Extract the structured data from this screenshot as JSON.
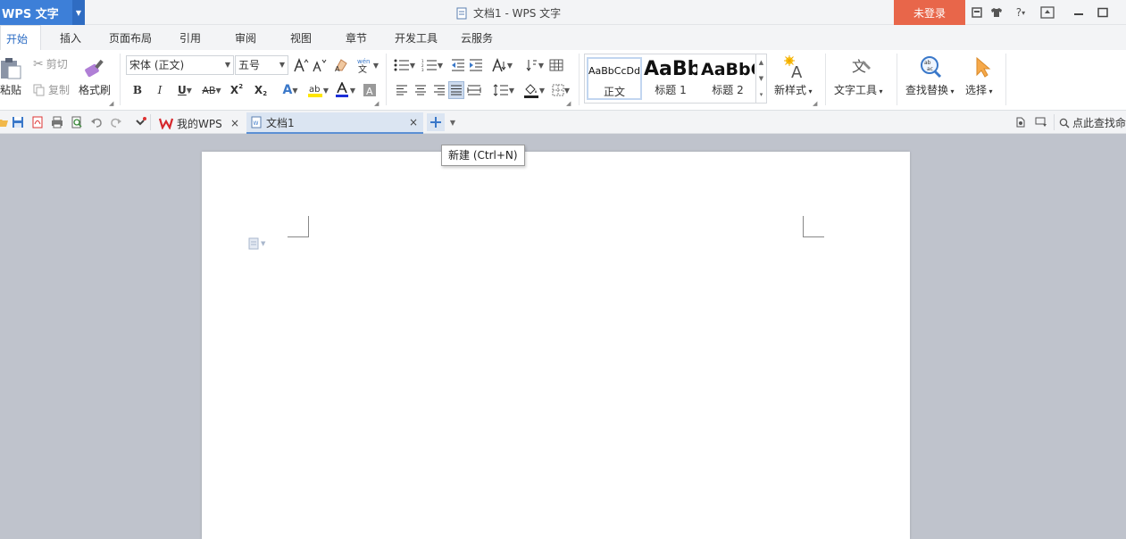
{
  "titlebar": {
    "app_name": "WPS 文字",
    "window_title": "文档1 - WPS 文字",
    "login_label": "未登录",
    "help_label": "?"
  },
  "ribbon_tabs": [
    {
      "label": "开始"
    },
    {
      "label": "插入"
    },
    {
      "label": "页面布局"
    },
    {
      "label": "引用"
    },
    {
      "label": "审阅"
    },
    {
      "label": "视图"
    },
    {
      "label": "章节"
    },
    {
      "label": "开发工具"
    },
    {
      "label": "云服务"
    }
  ],
  "clipboard": {
    "paste_label": "粘贴",
    "cut_label": "剪切",
    "copy_label": "复制",
    "format_painter_label": "格式刷"
  },
  "font": {
    "font_name": "宋体 (正文)",
    "font_size": "五号"
  },
  "styles": {
    "items": [
      {
        "sample": "AaBbCcDd",
        "caption": "正文"
      },
      {
        "sample": "AaBb",
        "caption": "标题 1"
      },
      {
        "sample": "AaBbC",
        "caption": "标题 2"
      }
    ],
    "new_style_label": "新样式",
    "text_tools_label": "文字工具",
    "find_replace_label": "查找替换",
    "select_label": "选择"
  },
  "doc_tabs": {
    "tabs": [
      {
        "label": "我的WPS"
      },
      {
        "label": "文档1"
      }
    ],
    "find_command_label": "点此查找命令"
  },
  "tooltip": {
    "text": "新建 (Ctrl+N)"
  },
  "colors": {
    "app_blue": "#3d7fd8",
    "login_red": "#e8664a",
    "active_tab_text": "#2b6cc4",
    "canvas_bg": "#bfc3cc"
  }
}
